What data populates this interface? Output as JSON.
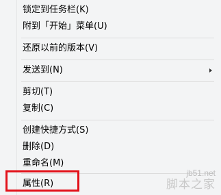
{
  "menu": {
    "items": [
      {
        "label": "锁定到任务栏(K)"
      },
      {
        "label": "附到「开始」菜单(U)"
      },
      {
        "label": "还原以前的版本(V)"
      },
      {
        "label": "发送到(N)"
      },
      {
        "label": "剪切(T)"
      },
      {
        "label": "复制(C)"
      },
      {
        "label": "创建快捷方式(S)"
      },
      {
        "label": "删除(D)"
      },
      {
        "label": "重命名(M)"
      },
      {
        "label": "属性(R)"
      }
    ]
  },
  "watermark": {
    "domain": "jb51.net",
    "name": "脚本之家"
  },
  "colors": {
    "highlight_border": "#e2111a",
    "menu_background": "#f3f4f5"
  },
  "icons": {
    "submenu": "chevron-right-icon"
  }
}
